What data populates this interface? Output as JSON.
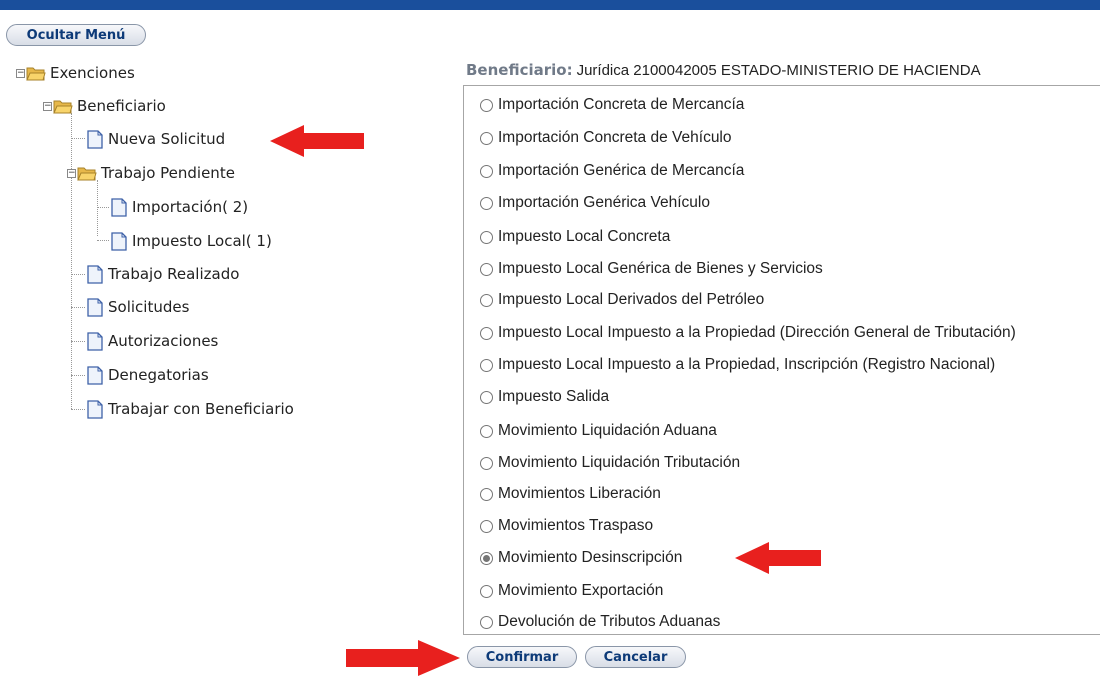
{
  "toolbar": {
    "hide_menu_label": "Ocultar Menú"
  },
  "tree": {
    "exenciones": "Exenciones",
    "beneficiario": "Beneficiario",
    "nueva_solicitud": "Nueva Solicitud",
    "trabajo_pendiente": "Trabajo Pendiente",
    "importacion": "Importación( 2)",
    "impuesto_local": "Impuesto Local( 1)",
    "trabajo_realizado": "Trabajo Realizado",
    "solicitudes": "Solicitudes",
    "autorizaciones": "Autorizaciones",
    "denegatorias": "Denegatorias",
    "trabajar_con_beneficiario": "Trabajar con Beneficiario"
  },
  "beneficiary": {
    "label": "Beneficiario:",
    "value": "Jurídica 2100042005 ESTADO-MINISTERIO DE HACIENDA"
  },
  "options": [
    {
      "label": "Importación Concreta de Mercancía",
      "selected": false
    },
    {
      "label": "Importación Concreta de Vehículo",
      "selected": false
    },
    {
      "label": "Importación Genérica de Mercancía",
      "selected": false
    },
    {
      "label": "Importación Genérica Vehículo",
      "selected": false
    },
    {
      "label": "Impuesto Local Concreta",
      "selected": false
    },
    {
      "label": "Impuesto Local Genérica de Bienes y Servicios",
      "selected": false
    },
    {
      "label": "Impuesto Local Derivados del Petróleo",
      "selected": false
    },
    {
      "label": "Impuesto Local Impuesto a la Propiedad (Dirección General de Tributación)",
      "selected": false
    },
    {
      "label": "Impuesto Local Impuesto a la Propiedad, Inscripción (Registro Nacional)",
      "selected": false
    },
    {
      "label": "Impuesto Salida",
      "selected": false
    },
    {
      "label": "Movimiento Liquidación Aduana",
      "selected": false
    },
    {
      "label": "Movimiento Liquidación Tributación",
      "selected": false
    },
    {
      "label": "Movimientos Liberación",
      "selected": false
    },
    {
      "label": "Movimientos Traspaso",
      "selected": false
    },
    {
      "label": "Movimiento Desinscripción",
      "selected": true
    },
    {
      "label": "Movimiento Exportación",
      "selected": false
    },
    {
      "label": "Devolución de Tributos Aduanas",
      "selected": false
    }
  ],
  "actions": {
    "confirm": "Confirmar",
    "cancel": "Cancelar"
  },
  "colors": {
    "accent_bar": "#1a4f9c",
    "button_text": "#0d3a78",
    "arrow": "#e8201e"
  }
}
